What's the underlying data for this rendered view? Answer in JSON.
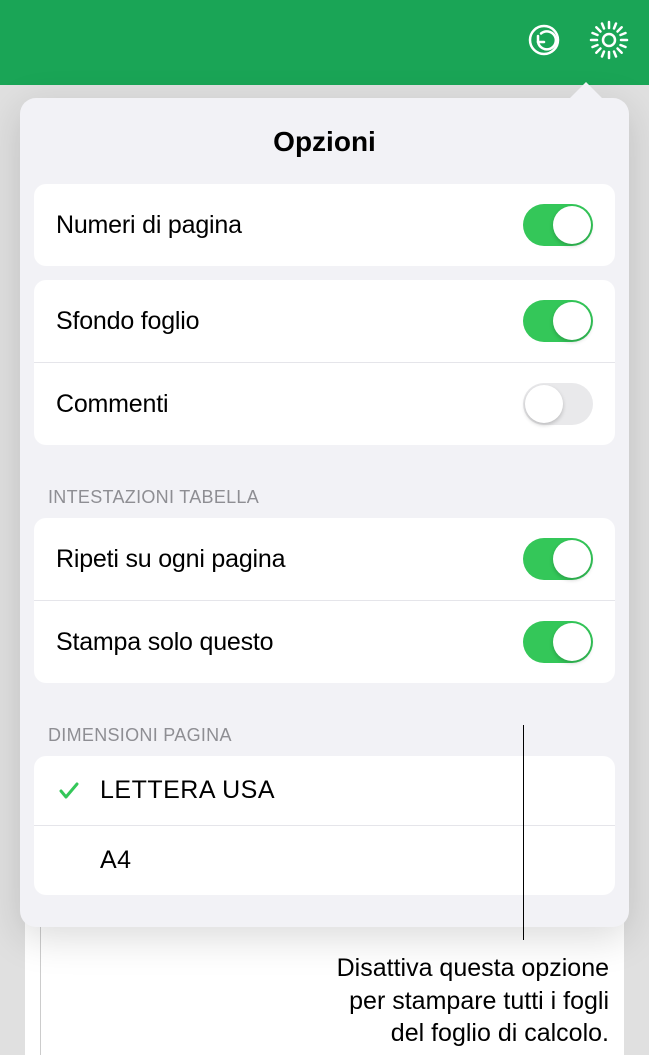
{
  "popover": {
    "title": "Opzioni"
  },
  "options": {
    "page_numbers": {
      "label": "Numeri di pagina",
      "on": true
    },
    "sheet_bg": {
      "label": "Sfondo foglio",
      "on": true
    },
    "comments": {
      "label": "Commenti",
      "on": false
    }
  },
  "headers_section": {
    "title": "INTESTAZIONI TABELLA",
    "repeat": {
      "label": "Ripeti su ogni pagina",
      "on": true
    },
    "print_only": {
      "label": "Stampa solo questo",
      "on": true
    }
  },
  "page_size_section": {
    "title": "DIMENSIONI PAGINA",
    "items": [
      {
        "label": "LETTERA USA",
        "selected": true
      },
      {
        "label": "A4",
        "selected": false
      }
    ]
  },
  "callout": {
    "line1": "Disattiva questa opzione",
    "line2": "per stampare tutti i fogli",
    "line3": "del foglio di calcolo."
  },
  "colors": {
    "accent": "#34c759",
    "toolbar": "#1aa556"
  }
}
